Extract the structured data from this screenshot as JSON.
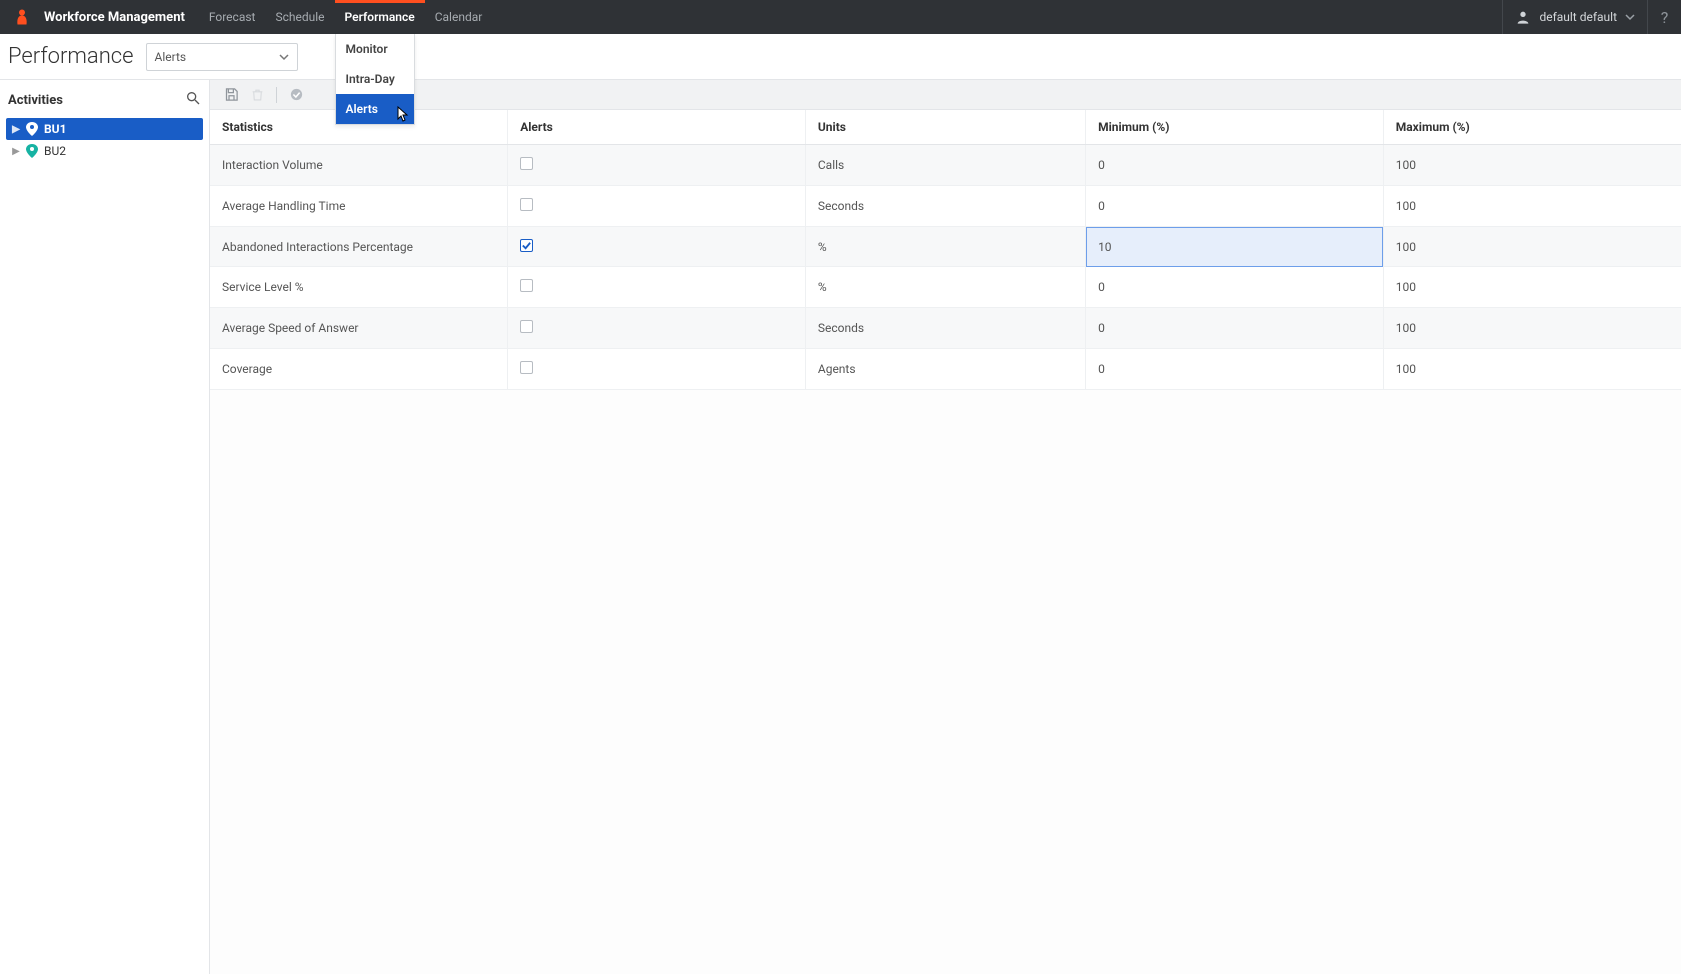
{
  "app_title": "Workforce Management",
  "nav": {
    "tabs": [
      "Forecast",
      "Schedule",
      "Performance",
      "Calendar"
    ],
    "active_index": 2
  },
  "user": {
    "name": "default default"
  },
  "dropdown": {
    "items": [
      "Monitor",
      "Intra-Day",
      "Alerts"
    ],
    "selected_index": 2
  },
  "subheader": {
    "title": "Performance",
    "selected_view": "Alerts"
  },
  "sidebar": {
    "title": "Activities",
    "items": [
      {
        "label": "BU1",
        "selected": true
      },
      {
        "label": "BU2",
        "selected": false
      }
    ]
  },
  "table": {
    "columns": [
      "Statistics",
      "Alerts",
      "Units",
      "Minimum (%)",
      "Maximum (%)"
    ],
    "rows": [
      {
        "stat": "Interaction Volume",
        "alert": false,
        "units": "Calls",
        "min": "0",
        "max": "100",
        "editing_min": false
      },
      {
        "stat": "Average Handling Time",
        "alert": false,
        "units": "Seconds",
        "min": "0",
        "max": "100",
        "editing_min": false
      },
      {
        "stat": "Abandoned Interactions Percentage",
        "alert": true,
        "units": "%",
        "min": "10",
        "max": "100",
        "editing_min": true
      },
      {
        "stat": "Service Level %",
        "alert": false,
        "units": "%",
        "min": "0",
        "max": "100",
        "editing_min": false
      },
      {
        "stat": "Average Speed of Answer",
        "alert": false,
        "units": "Seconds",
        "min": "0",
        "max": "100",
        "editing_min": false
      },
      {
        "stat": "Coverage",
        "alert": false,
        "units": "Agents",
        "min": "0",
        "max": "100",
        "editing_min": false
      }
    ]
  },
  "colors": {
    "accent_orange": "#ff4f1f",
    "accent_blue": "#195dc6"
  }
}
